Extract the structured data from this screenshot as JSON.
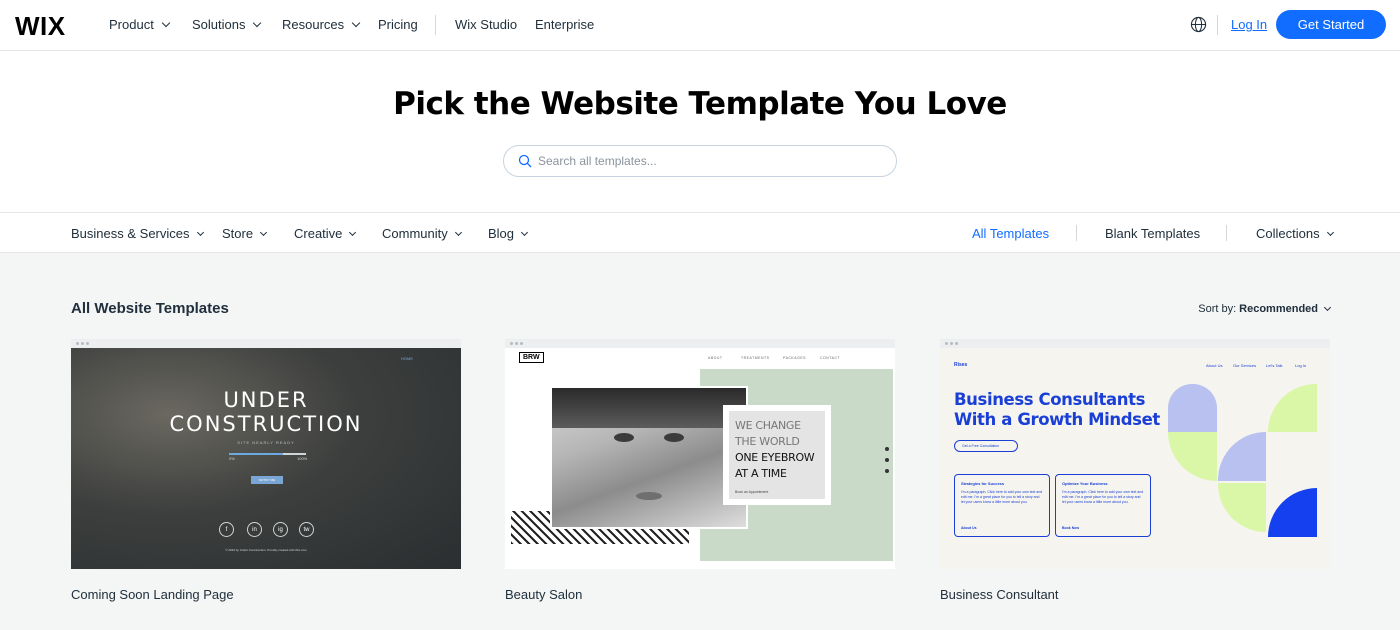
{
  "brand": {
    "logo": "WIX",
    "accent": "#116dff"
  },
  "topnav": {
    "items": [
      {
        "label": "Product",
        "dropdown": true
      },
      {
        "label": "Solutions",
        "dropdown": true
      },
      {
        "label": "Resources",
        "dropdown": true
      },
      {
        "label": "Pricing",
        "dropdown": false
      },
      {
        "label": "Wix Studio",
        "dropdown": false
      },
      {
        "label": "Enterprise",
        "dropdown": false
      }
    ],
    "globe_icon": "globe-icon",
    "login": "Log In",
    "get_started": "Get Started"
  },
  "hero": {
    "title": "Pick the Website Template You Love",
    "search_placeholder": "Search all templates...",
    "search_value": ""
  },
  "categories": {
    "left": [
      {
        "label": "Business & Services"
      },
      {
        "label": "Store"
      },
      {
        "label": "Creative"
      },
      {
        "label": "Community"
      },
      {
        "label": "Blog"
      }
    ],
    "right": [
      {
        "label": "All Templates",
        "active": true
      },
      {
        "label": "Blank Templates",
        "active": false
      },
      {
        "label": "Collections",
        "active": false,
        "dropdown": true
      }
    ]
  },
  "listing": {
    "title": "All Website Templates",
    "sort_prefix": "Sort by:",
    "sort_value": "Recommended"
  },
  "templates": [
    {
      "name": "Coming Soon Landing Page",
      "preview": {
        "title_line1": "UNDER",
        "title_line2": "CONSTRUCTION",
        "subtitle": "SITE NEARLY READY",
        "progress_start": "0%",
        "progress_end": "100%",
        "progress": 0.7,
        "button": "NOTIFY ME",
        "home": "HOME",
        "social": [
          "f",
          "in",
          "ig",
          "tw"
        ],
        "footer": "© 2023 by Under Construction. Proudly created with Wix.com"
      }
    },
    {
      "name": "Beauty Salon",
      "preview": {
        "logo": "BRW",
        "menu": [
          "ABOUT",
          "TREATMENTS",
          "PACKAGES",
          "CONTACT"
        ],
        "line1": "WE CHANGE",
        "line2": "THE WORLD",
        "line3": "ONE EYEBROW",
        "line4": "AT A TIME",
        "link": "Book an Appointment"
      }
    },
    {
      "name": "Business Consultant",
      "preview": {
        "logo": "Rises",
        "menu": [
          "About Us",
          "Our Services",
          "Let's Talk",
          "Log In"
        ],
        "headline_line1": "Business Consultants",
        "headline_line2": "With a Growth Mindset",
        "cta": "Get a Free Consultation",
        "card1_title": "Strategies for Success",
        "card1_text": "I'm a paragraph. Click here to add your own text and edit me. I'm a great place for you to tell a story and let your users know a little more about you.",
        "card1_link": "About Us",
        "card2_title": "Optimize Your Business",
        "card2_text": "I'm a paragraph. Click here to add your own text and edit me. I'm a great place for you to tell a story and let your users know a little more about you.",
        "card2_link": "Book Now",
        "colors": {
          "blue": "#1a3fd6",
          "lilac": "#b8c1f0",
          "lime": "#d9f7a6"
        }
      }
    }
  ]
}
